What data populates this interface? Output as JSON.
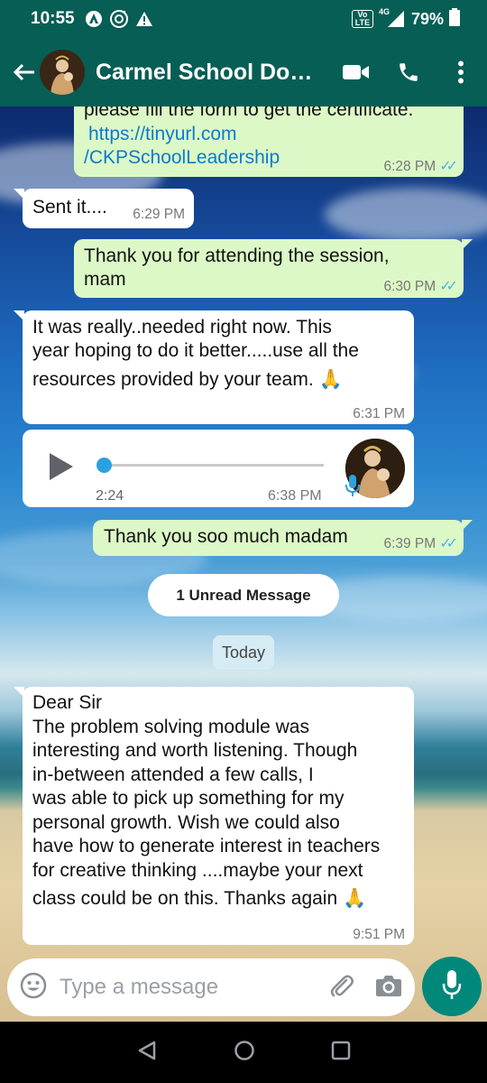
{
  "status_bar": {
    "time": "10:55",
    "battery": "79%",
    "network": "4G",
    "volte": "Vo LTE"
  },
  "header": {
    "title": "Carmel School Dore...",
    "icons": [
      "back-arrow-icon",
      "video-call-icon",
      "voice-call-icon",
      "more-options-icon"
    ]
  },
  "messages": [
    {
      "direction": "out",
      "lines": [
        "please fill the form to get the certificate."
      ],
      "links": [
        "https://tinyurl.com",
        "/CKPSchoolLeadership"
      ],
      "time": "6:28 PM",
      "status": "read"
    },
    {
      "direction": "in",
      "text": "Sent it....",
      "time": "6:29 PM"
    },
    {
      "direction": "out",
      "lines": [
        "Thank you for attending the session,",
        "mam"
      ],
      "time": "6:30 PM",
      "status": "read"
    },
    {
      "direction": "in",
      "lines": [
        "It was really..needed right now. This",
        "year hoping to do it better.....use all the",
        "resources provided by your team. 🙏"
      ],
      "time": "6:31 PM"
    },
    {
      "direction": "in",
      "type": "voice",
      "duration": "2:24",
      "time": "6:38 PM"
    },
    {
      "direction": "out",
      "text": "Thank you soo much madam",
      "time": "6:39 PM",
      "status": "read"
    },
    {
      "direction": "in",
      "lines": [
        "Dear Sir",
        "The problem solving module was",
        "interesting and worth listening.  Though",
        "in-between attended a few calls, I",
        "was able to pick up something for my",
        "personal growth.  Wish we could also",
        "have how to generate interest in teachers",
        "for creative thinking ....maybe your next",
        "class could be on this. Thanks again 🙏"
      ],
      "time": "9:51 PM"
    }
  ],
  "unread_label": "1 Unread Message",
  "date_label": "Today",
  "input": {
    "placeholder": "Type a message"
  },
  "colors": {
    "header": "#075e54",
    "outgoing_bubble": "#dcf8c6",
    "incoming_bubble": "#ffffff",
    "read_ticks": "#4fb3e8",
    "mic_button": "#00897b"
  }
}
